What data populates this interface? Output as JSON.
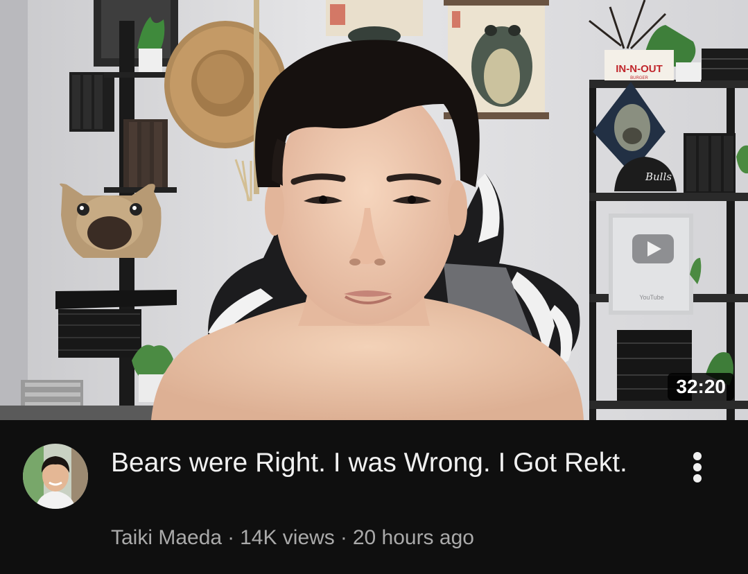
{
  "video": {
    "duration": "32:20",
    "title": "Bears were Right. I was Wrong. I Got Rekt.",
    "channel": "Taiki Maeda",
    "views": "14K views",
    "age": "20 hours ago",
    "separator": "·"
  },
  "icons": {
    "menu": "more-vertical-icon",
    "channel_avatar": "channel-avatar"
  },
  "colors": {
    "background": "#0f0f0f",
    "title_text": "#f1f1f1",
    "secondary_text": "#aaaaaa",
    "duration_badge": "#000000"
  },
  "thumbnail_text": {
    "can_label": "IN-N-OUT",
    "can_sub": "BURGER",
    "hat_text": "Bulls",
    "plaque_brand": "YouTube"
  }
}
